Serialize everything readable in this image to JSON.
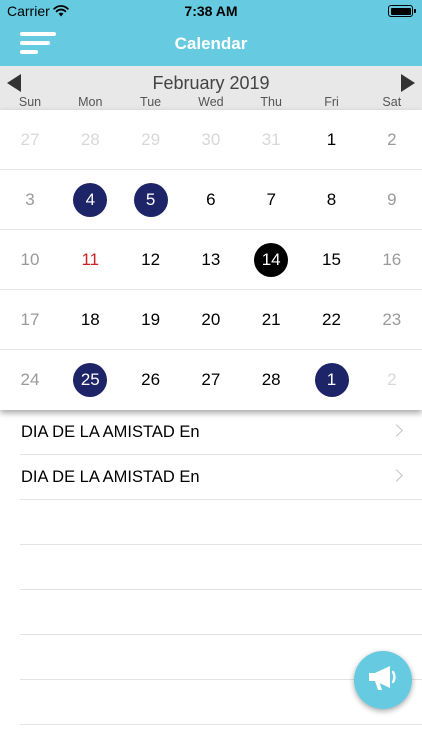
{
  "status_bar": {
    "carrier": "Carrier",
    "time": "7:38 AM"
  },
  "nav": {
    "title": "Calendar",
    "menu_icon": "hamburger-menu-icon"
  },
  "calendar": {
    "month_label": "February 2019",
    "prev_icon": "triangle-left-icon",
    "next_icon": "triangle-right-icon",
    "weekdays": [
      "Sun",
      "Mon",
      "Tue",
      "Wed",
      "Thu",
      "Fri",
      "Sat"
    ],
    "weeks": [
      [
        {
          "d": "27",
          "s": "out"
        },
        {
          "d": "28",
          "s": "out"
        },
        {
          "d": "29",
          "s": "out"
        },
        {
          "d": "30",
          "s": "out"
        },
        {
          "d": "31",
          "s": "out"
        },
        {
          "d": "1",
          "s": ""
        },
        {
          "d": "2",
          "s": "weekend"
        }
      ],
      [
        {
          "d": "3",
          "s": "weekend"
        },
        {
          "d": "4",
          "s": "event"
        },
        {
          "d": "5",
          "s": "event"
        },
        {
          "d": "6",
          "s": ""
        },
        {
          "d": "7",
          "s": ""
        },
        {
          "d": "8",
          "s": ""
        },
        {
          "d": "9",
          "s": "weekend"
        }
      ],
      [
        {
          "d": "10",
          "s": "weekend"
        },
        {
          "d": "11",
          "s": "holiday"
        },
        {
          "d": "12",
          "s": ""
        },
        {
          "d": "13",
          "s": ""
        },
        {
          "d": "14",
          "s": "today"
        },
        {
          "d": "15",
          "s": ""
        },
        {
          "d": "16",
          "s": "weekend"
        }
      ],
      [
        {
          "d": "17",
          "s": "weekend"
        },
        {
          "d": "18",
          "s": ""
        },
        {
          "d": "19",
          "s": ""
        },
        {
          "d": "20",
          "s": ""
        },
        {
          "d": "21",
          "s": ""
        },
        {
          "d": "22",
          "s": ""
        },
        {
          "d": "23",
          "s": "weekend"
        }
      ],
      [
        {
          "d": "24",
          "s": "weekend"
        },
        {
          "d": "25",
          "s": "event"
        },
        {
          "d": "26",
          "s": ""
        },
        {
          "d": "27",
          "s": ""
        },
        {
          "d": "28",
          "s": ""
        },
        {
          "d": "1",
          "s": "event"
        },
        {
          "d": "2",
          "s": "out"
        }
      ]
    ]
  },
  "events": [
    {
      "label": "DIA DE LA AMISTAD En"
    },
    {
      "label": "DIA DE LA AMISTAD En"
    }
  ],
  "empty_rows": 5,
  "fab": {
    "icon": "megaphone-icon"
  },
  "colors": {
    "accent": "#66cbe0",
    "event_circle": "#1e2468",
    "today_circle": "#000000",
    "holiday_text": "#cc2222"
  }
}
